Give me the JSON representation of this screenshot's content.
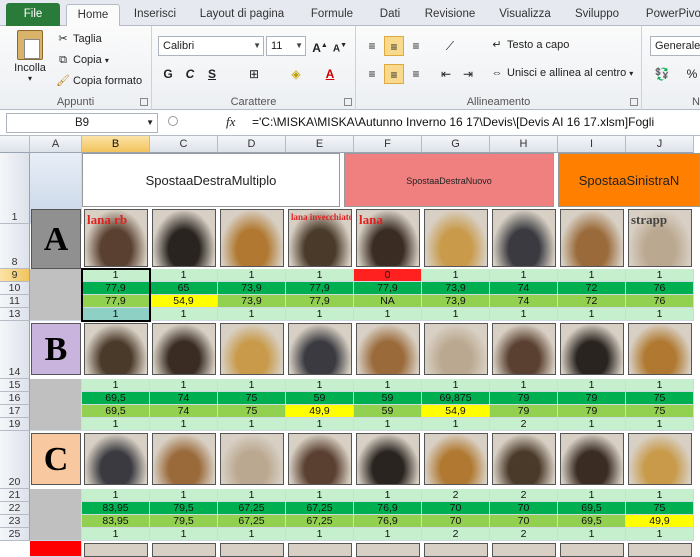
{
  "tabs": [
    "File",
    "Home",
    "Inserisci",
    "Layout di pagina",
    "Formule",
    "Dati",
    "Revisione",
    "Visualizza",
    "Sviluppo",
    "PowerPivot"
  ],
  "ribbon": {
    "clipboard": {
      "paste": "Incolla",
      "cut": "Taglia",
      "copy": "Copia",
      "format_painter": "Copia formato",
      "label": "Appunti"
    },
    "font": {
      "name": "Calibri",
      "size": "11",
      "bold": "G",
      "italic": "C",
      "underline": "S",
      "label": "Carattere"
    },
    "alignment": {
      "wrap": "Testo a capo",
      "merge": "Unisci e allinea al centro",
      "label": "Allineamento"
    },
    "number": {
      "format": "Generale",
      "percent": "%",
      "label": "Nu"
    }
  },
  "formula_bar": {
    "name_box": "B9",
    "fx": "fx",
    "formula": "='C:\\MISKA\\MISKA\\Autunno Inverno 16 17\\Devis\\[Devis AI 16 17.xlsm]Fogli"
  },
  "columns": [
    "A",
    "B",
    "C",
    "D",
    "E",
    "F",
    "G",
    "H",
    "I",
    "J"
  ],
  "row_numbers": [
    "1",
    "8",
    "9",
    "10",
    "11",
    "13",
    "14",
    "15",
    "16",
    "17",
    "19",
    "20",
    "21",
    "22",
    "23",
    "25"
  ],
  "header_boxes": [
    {
      "label": "SpostaaDestraMultiplo",
      "color": "#ffffff"
    },
    {
      "label": "SpostaaDestraNuovo",
      "color": "#f08080"
    },
    {
      "label": "SpostaaSinistraN",
      "color": "#ff7f00"
    }
  ],
  "groups": [
    {
      "letter": "A",
      "letter_color": "#909090",
      "photo_captions": [
        "lana rb",
        "",
        "",
        "lana invecchiato",
        "lana",
        "",
        "",
        "",
        "strapp"
      ],
      "rows": [
        {
          "values": [
            "1",
            "1",
            "1",
            "1",
            "0",
            "1",
            "1",
            "1",
            "1"
          ],
          "colors": [
            "#c6efce",
            "#c6efce",
            "#c6efce",
            "#c6efce",
            "#ff2020",
            "#c6efce",
            "#c6efce",
            "#c6efce",
            "#c6efce"
          ]
        },
        {
          "values": [
            "77,9",
            "65",
            "73,9",
            "77,9",
            "77,9",
            "73,9",
            "74",
            "72",
            "76"
          ],
          "colors": [
            "#00b050",
            "#00b050",
            "#00b050",
            "#00b050",
            "#00b050",
            "#00b050",
            "#00b050",
            "#00b050",
            "#00b050"
          ]
        },
        {
          "values": [
            "77,9",
            "54,9",
            "73,9",
            "77,9",
            "NA",
            "73,9",
            "74",
            "72",
            "76"
          ],
          "colors": [
            "#92d050",
            "#ffff00",
            "#92d050",
            "#92d050",
            "#92d050",
            "#92d050",
            "#92d050",
            "#92d050",
            "#92d050"
          ]
        },
        {
          "values": [
            "1",
            "1",
            "1",
            "1",
            "1",
            "1",
            "1",
            "1",
            "1"
          ],
          "colors": [
            "#8ed0c4",
            "#c6efce",
            "#c6efce",
            "#c6efce",
            "#c6efce",
            "#c6efce",
            "#c6efce",
            "#c6efce",
            "#c6efce"
          ]
        }
      ]
    },
    {
      "letter": "B",
      "letter_color": "#c8b4dc",
      "photo_captions": [
        "",
        "",
        "",
        "",
        "",
        "",
        "",
        "",
        ""
      ],
      "rows": [
        {
          "values": [
            "1",
            "1",
            "1",
            "1",
            "1",
            "1",
            "1",
            "1",
            "1"
          ],
          "colors": [
            "#c6efce",
            "#c6efce",
            "#c6efce",
            "#c6efce",
            "#c6efce",
            "#c6efce",
            "#c6efce",
            "#c6efce",
            "#c6efce"
          ]
        },
        {
          "values": [
            "69,5",
            "74",
            "75",
            "59",
            "59",
            "69,875",
            "79",
            "79",
            "75"
          ],
          "colors": [
            "#00b050",
            "#00b050",
            "#00b050",
            "#00b050",
            "#00b050",
            "#00b050",
            "#00b050",
            "#00b050",
            "#00b050"
          ]
        },
        {
          "values": [
            "69,5",
            "74",
            "75",
            "49,9",
            "59",
            "54,9",
            "79",
            "79",
            "75"
          ],
          "colors": [
            "#92d050",
            "#92d050",
            "#92d050",
            "#ffff00",
            "#92d050",
            "#ffff00",
            "#92d050",
            "#92d050",
            "#92d050"
          ]
        },
        {
          "values": [
            "1",
            "1",
            "1",
            "1",
            "1",
            "1",
            "2",
            "1",
            "1"
          ],
          "colors": [
            "#c6efce",
            "#c6efce",
            "#c6efce",
            "#c6efce",
            "#c6efce",
            "#c6efce",
            "#c6efce",
            "#c6efce",
            "#c6efce"
          ]
        }
      ]
    },
    {
      "letter": "C",
      "letter_color": "#f8c8a0",
      "photo_captions": [
        "",
        "",
        "",
        "",
        "",
        "",
        "",
        "",
        ""
      ],
      "rows": [
        {
          "values": [
            "1",
            "1",
            "1",
            "1",
            "1",
            "2",
            "2",
            "1",
            "1"
          ],
          "colors": [
            "#c6efce",
            "#c6efce",
            "#c6efce",
            "#c6efce",
            "#c6efce",
            "#c6efce",
            "#c6efce",
            "#c6efce",
            "#c6efce"
          ]
        },
        {
          "values": [
            "83,95",
            "79,5",
            "67,25",
            "67,25",
            "76,9",
            "70",
            "70",
            "69,5",
            "75"
          ],
          "colors": [
            "#00b050",
            "#00b050",
            "#00b050",
            "#00b050",
            "#00b050",
            "#00b050",
            "#00b050",
            "#00b050",
            "#00b050"
          ]
        },
        {
          "values": [
            "83,95",
            "79,5",
            "67,25",
            "67,25",
            "76,9",
            "70",
            "70",
            "69,5",
            "49,9"
          ],
          "colors": [
            "#92d050",
            "#92d050",
            "#92d050",
            "#92d050",
            "#92d050",
            "#92d050",
            "#92d050",
            "#92d050",
            "#ffff00"
          ]
        },
        {
          "values": [
            "1",
            "1",
            "1",
            "1",
            "1",
            "2",
            "2",
            "1",
            "1"
          ],
          "colors": [
            "#c6efce",
            "#c6efce",
            "#c6efce",
            "#c6efce",
            "#c6efce",
            "#c6efce",
            "#c6efce",
            "#c6efce",
            "#c6efce"
          ]
        }
      ]
    }
  ]
}
